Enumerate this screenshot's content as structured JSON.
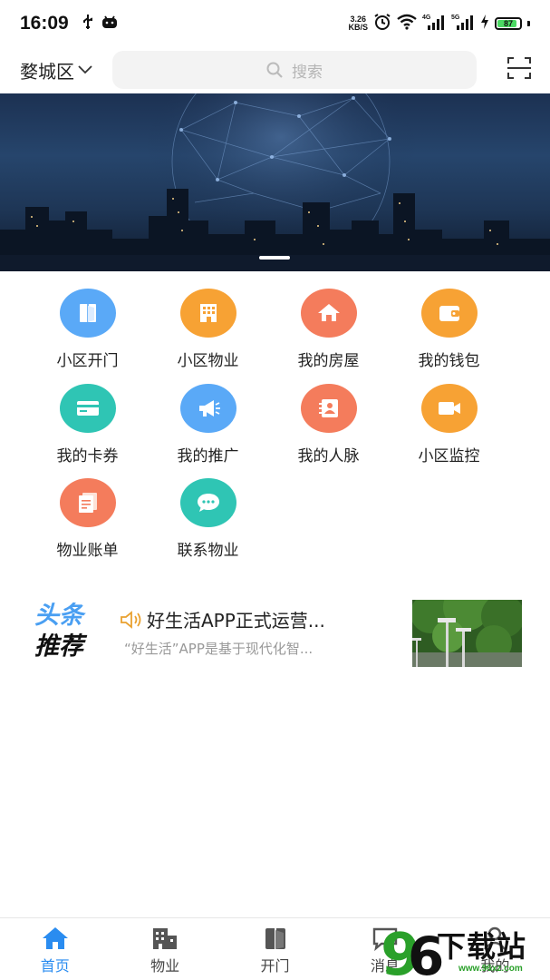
{
  "status_bar": {
    "time": "16:09",
    "net_speed_value": "3.26",
    "net_speed_unit": "KB/S",
    "sig1": "4G",
    "sig2": "5G",
    "battery": "87",
    "battery_level": 0.87
  },
  "header": {
    "city": "婺城区",
    "search_placeholder": "搜索"
  },
  "grid": [
    {
      "label": "小区开门",
      "icon": "door-icon",
      "color": "#5aa9f7"
    },
    {
      "label": "小区物业",
      "icon": "building-icon",
      "color": "#f7a234"
    },
    {
      "label": "我的房屋",
      "icon": "house-icon",
      "color": "#f47c5c"
    },
    {
      "label": "我的钱包",
      "icon": "wallet-icon",
      "color": "#f7a234"
    },
    {
      "label": "我的卡券",
      "icon": "card-icon",
      "color": "#2fc5b4"
    },
    {
      "label": "我的推广",
      "icon": "megaphone-icon",
      "color": "#5aa9f7"
    },
    {
      "label": "我的人脉",
      "icon": "contacts-icon",
      "color": "#f47c5c"
    },
    {
      "label": "小区监控",
      "icon": "camera-icon",
      "color": "#f7a234"
    },
    {
      "label": "物业账单",
      "icon": "bill-icon",
      "color": "#f47c5c"
    },
    {
      "label": "联系物业",
      "icon": "chat-icon",
      "color": "#2fc5b4"
    }
  ],
  "news": {
    "tag_line1": "头条",
    "tag_line2": "推荐",
    "title": "好生活APP正式运营...",
    "subtitle": "“好生活”APP是基于现代化智..."
  },
  "tabbar": [
    {
      "label": "首页",
      "icon": "home-icon"
    },
    {
      "label": "物业",
      "icon": "building-icon"
    },
    {
      "label": "开门",
      "icon": "door-icon"
    },
    {
      "label": "消息",
      "icon": "message-icon"
    },
    {
      "label": "我的",
      "icon": "profile-icon"
    }
  ],
  "watermark": {
    "brand": "下载站",
    "url": "www.96xz.com"
  },
  "colors": {
    "accent": "#2a8cf0",
    "tag_blue": "#4a9ff2"
  }
}
